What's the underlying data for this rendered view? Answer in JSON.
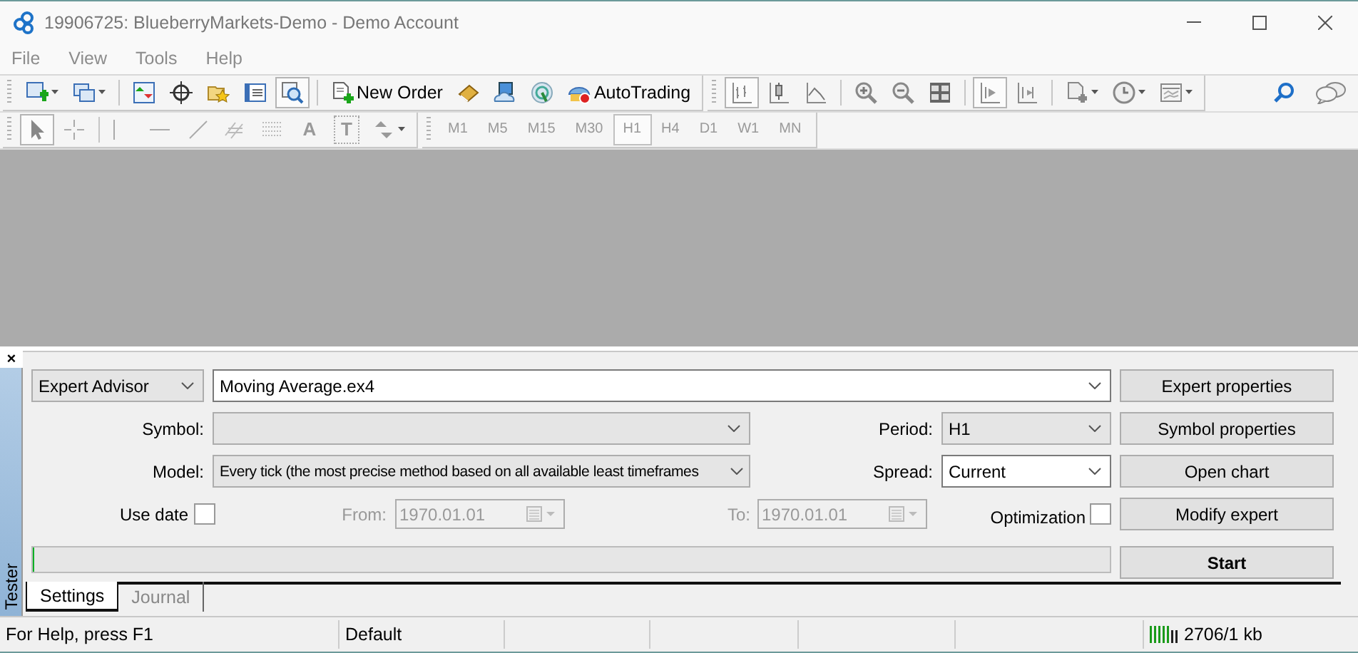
{
  "window": {
    "title": "19906725: BlueberryMarkets-Demo - Demo Account"
  },
  "menu": [
    {
      "label": "File"
    },
    {
      "label": "View"
    },
    {
      "label": "Tools"
    },
    {
      "label": "Help"
    }
  ],
  "toolbar_rows": [
    [
      [
        [
          {
            "kind": "icon",
            "dropdown": true,
            "pressed": false
          },
          {
            "kind": "icon",
            "dropdown": true,
            "pressed": false
          }
        ],
        [
          {
            "kind": "icon",
            "dropdown": false,
            "pressed": false
          },
          {
            "kind": "icon",
            "dropdown": false,
            "pressed": false
          },
          {
            "kind": "icon",
            "dropdown": false,
            "pressed": false
          },
          {
            "kind": "icon",
            "dropdown": false,
            "pressed": false
          },
          {
            "kind": "icon",
            "dropdown": false,
            "pressed": true
          }
        ],
        [
          {
            "kind": "labeled",
            "label": "New Order"
          },
          {
            "kind": "icon",
            "dropdown": false,
            "pressed": false
          },
          {
            "kind": "icon",
            "dropdown": false,
            "pressed": false
          },
          {
            "kind": "icon",
            "dropdown": false,
            "pressed": false
          },
          {
            "kind": "labeled",
            "label": "AutoTrading"
          }
        ]
      ],
      [
        [
          {
            "kind": "icon",
            "dropdown": false,
            "pressed": true
          },
          {
            "kind": "icon",
            "dropdown": false,
            "pressed": false
          },
          {
            "kind": "icon",
            "dropdown": false,
            "pressed": false
          }
        ],
        [
          {
            "kind": "icon",
            "dropdown": false,
            "pressed": false
          },
          {
            "kind": "icon",
            "dropdown": false,
            "pressed": false
          },
          {
            "kind": "icon",
            "dropdown": false,
            "pressed": false
          }
        ],
        [
          {
            "kind": "icon",
            "dropdown": false,
            "pressed": true
          },
          {
            "kind": "icon",
            "dropdown": false,
            "pressed": false
          }
        ],
        [
          {
            "kind": "icon",
            "dropdown": true,
            "pressed": false
          },
          {
            "kind": "icon",
            "dropdown": true,
            "pressed": false
          },
          {
            "kind": "icon",
            "dropdown": true,
            "pressed": false
          }
        ]
      ]
    ],
    [
      [
        [
          {
            "kind": "icon",
            "dropdown": false,
            "pressed": true
          },
          {
            "kind": "icon",
            "dropdown": false,
            "pressed": false
          }
        ],
        [
          {
            "kind": "icon",
            "dropdown": false,
            "pressed": false
          },
          {
            "kind": "icon",
            "dropdown": false,
            "pressed": false
          },
          {
            "kind": "icon",
            "dropdown": false,
            "pressed": false
          },
          {
            "kind": "icon",
            "dropdown": false,
            "pressed": false
          },
          {
            "kind": "icon",
            "dropdown": false,
            "pressed": false
          },
          {
            "kind": "glyph",
            "label": "A"
          },
          {
            "kind": "boxed_glyph",
            "label": "T"
          },
          {
            "kind": "icon",
            "dropdown": true,
            "pressed": false
          }
        ]
      ],
      [
        [
          {
            "kind": "text",
            "label": "M1",
            "selected": false
          },
          {
            "kind": "text",
            "label": "M5",
            "selected": false
          },
          {
            "kind": "text",
            "label": "M15",
            "selected": false
          },
          {
            "kind": "text",
            "label": "M30",
            "selected": false
          },
          {
            "kind": "text",
            "label": "H1",
            "selected": true
          },
          {
            "kind": "text",
            "label": "H4",
            "selected": false
          },
          {
            "kind": "text",
            "label": "D1",
            "selected": false
          },
          {
            "kind": "text",
            "label": "W1",
            "selected": false
          },
          {
            "kind": "text",
            "label": "MN",
            "selected": false
          }
        ]
      ]
    ]
  ],
  "tester": {
    "close_glyph": "×",
    "side_label": "Tester",
    "mode": {
      "value": "Expert Advisor"
    },
    "expert": {
      "value": "Moving Average.ex4"
    },
    "symbol": {
      "label": "Symbol:",
      "disabled": true
    },
    "model": {
      "label": "Model:",
      "value": "Every tick (the most precise method based on all available least timeframes",
      "disabled": true
    },
    "period": {
      "label": "Period:",
      "value": "H1",
      "disabled": true
    },
    "spread": {
      "label": "Spread:",
      "value": "Current",
      "disabled": false
    },
    "use_date": {
      "label": "Use date",
      "checked": false
    },
    "from": {
      "label": "From:",
      "value": "1970.01.01",
      "disabled": true
    },
    "to": {
      "label": "To:",
      "value": "1970.01.01",
      "disabled": true
    },
    "optimization": {
      "label": "Optimization",
      "checked": false
    },
    "progress": {
      "level": 0
    },
    "buttons": [
      {
        "label": "Expert properties",
        "primary": false
      },
      {
        "label": "Symbol properties",
        "primary": false
      },
      {
        "label": "Open chart",
        "primary": false
      },
      {
        "label": "Modify expert",
        "primary": false
      }
    ],
    "start_button": {
      "label": "Start",
      "primary": true
    },
    "tabs": [
      {
        "label": "Settings",
        "selected": true
      },
      {
        "label": "Journal",
        "selected": false
      }
    ]
  },
  "status_bar": {
    "help": "For Help, press F1",
    "profile": "Default",
    "traffic": "2706/1 kb"
  }
}
